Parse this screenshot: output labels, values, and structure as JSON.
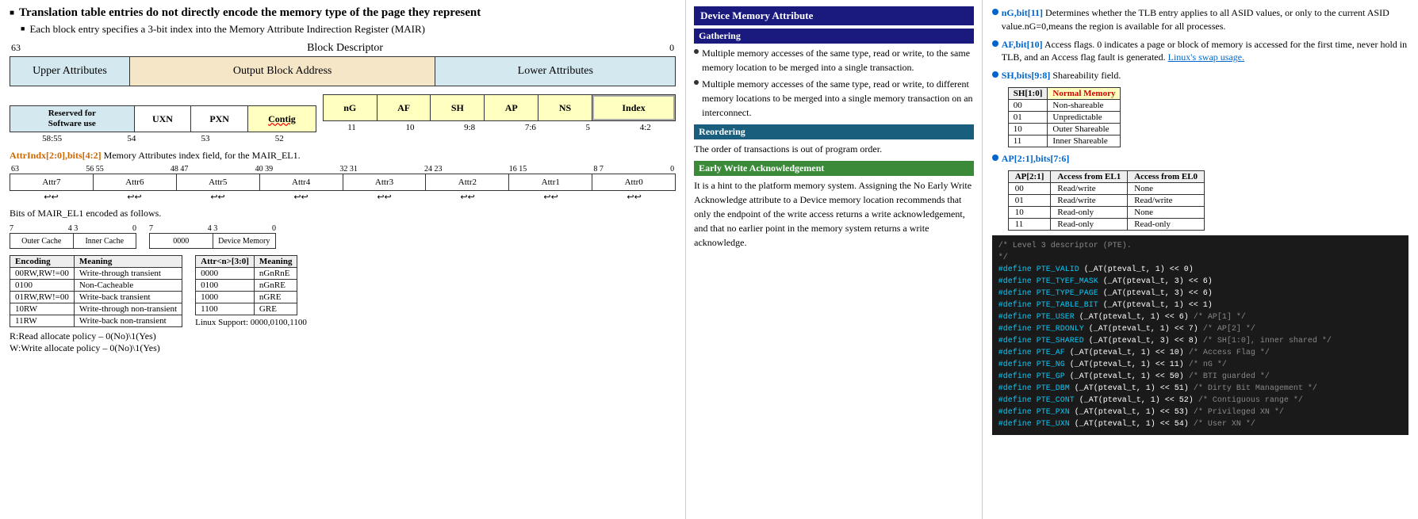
{
  "header": {
    "title": "Translation table entries do not directly encode the memory type of the page they represent",
    "subtitle": "Each block entry specifies a 3-bit index into the Memory Attribute Indirection Register (MAIR)"
  },
  "block_descriptor": {
    "title": "Block Descriptor",
    "bit_high": "63",
    "bit_low": "0",
    "boxes": [
      {
        "label": "Upper Attributes",
        "type": "upper"
      },
      {
        "label": "Output Block Address",
        "type": "output"
      },
      {
        "label": "Lower Attributes",
        "type": "lower"
      }
    ]
  },
  "lower_attrs": {
    "cells": [
      {
        "label": "Reserved for\nSoftware use",
        "type": "reserved",
        "bits": "58:55"
      },
      {
        "label": "UXN",
        "type": "uxn",
        "bits": "54"
      },
      {
        "label": "PXN",
        "type": "pxn",
        "bits": "53"
      },
      {
        "label": "Contig",
        "type": "contig",
        "bits": "52"
      },
      {
        "label": "nG",
        "type": "ng",
        "bits": "11"
      },
      {
        "label": "AF",
        "type": "af",
        "bits": "10"
      },
      {
        "label": "SH",
        "type": "sh",
        "bits": "9:8"
      },
      {
        "label": "AP",
        "type": "ap",
        "bits": "7:6"
      },
      {
        "label": "NS",
        "type": "ns",
        "bits": "5"
      },
      {
        "label": "Index",
        "type": "index",
        "bits": "4:2"
      }
    ]
  },
  "attr_indx": {
    "title_blue": "AttrIndx[2:0],bits[4:2]",
    "title_rest": " Memory Attributes index field, for the MAIR_EL1.",
    "bit_positions": [
      "63",
      "56 55",
      "48 47",
      "40 39",
      "32 31",
      "24 23",
      "16 15",
      "8  7",
      "0"
    ],
    "attr_labels": [
      "Attr7",
      "Attr6",
      "Attr5",
      "Attr4",
      "Attr3",
      "Attr2",
      "Attr1",
      "Attr0"
    ],
    "arrows": [
      "↩↩",
      "↩↩",
      "↩↩",
      "↩↩",
      "↩↩",
      "↩↩",
      "↩↩",
      "↩↩"
    ]
  },
  "mair_text": "Bits of MAIR_EL1 encoded as follows.",
  "mair_outer": {
    "bit_labels": [
      "7",
      "4 3",
      "0"
    ],
    "box_labels": [
      "Outer Cache",
      "Inner Cache"
    ],
    "sub_labels": [
      "0000",
      "Device Memory"
    ]
  },
  "encoding_table": {
    "headers": [
      "Encoding",
      "Meaning"
    ],
    "rows": [
      {
        "enc": "00RW,RW!=00",
        "meaning": "Write-through transient"
      },
      {
        "enc": "0100",
        "meaning": "Non-Cacheable"
      },
      {
        "enc": "01RW,RW!=00",
        "meaning": "Write-back transient"
      },
      {
        "enc": "10RW",
        "meaning": "Write-through non-transient"
      },
      {
        "enc": "11RW",
        "meaning": "Write-back non-transient"
      }
    ]
  },
  "attr_table": {
    "headers": [
      "Attr<n>[3:0]",
      "Meaning"
    ],
    "rows": [
      {
        "attr": "0000",
        "meaning": "nGnRnE"
      },
      {
        "attr": "0100",
        "meaning": "nGnRE"
      },
      {
        "attr": "1000",
        "meaning": "nGRE"
      },
      {
        "attr": "1100",
        "meaning": "GRE"
      }
    ],
    "linux_note": "Linux Support: 0000,0100,1100"
  },
  "rw_notes": [
    "R:Read allocate policy – 0(No)\\1(Yes)",
    "W:Write allocate policy – 0(No)\\1(Yes)"
  ],
  "right_panel": {
    "ng_text": "nG,bit[11]",
    "ng_desc": " Determines whether the TLB entry applies to all ASID values, or only to the current ASID value.nG=0,means the region is available for all processes.",
    "af_text": "AF,bit[10]",
    "af_desc": " Access flags. 0 indicates a page or block of memory is accessed for the first time, never hold in TLB, and an Access flag fault is generated. ",
    "af_link": "Linux's swap usage.",
    "sh_text": "SH,bits[9:8]",
    "sh_desc": " Shareability field.",
    "sh_table": {
      "headers": [
        "SH[1:0]",
        "Normal Memory"
      ],
      "rows": [
        {
          "val": "00",
          "meaning": "Non-shareable"
        },
        {
          "val": "01",
          "meaning": "Unpredictable"
        },
        {
          "val": "10",
          "meaning": "Outer Shareable"
        },
        {
          "val": "11",
          "meaning": "Inner Shareable"
        }
      ]
    },
    "ap_text": "AP[2:1],bits[7:6]",
    "ap_table": {
      "headers": [
        "AP[2:1]",
        "Access from EL1",
        "Access from EL0"
      ],
      "rows": [
        {
          "val": "00",
          "el1": "Read/write",
          "el0": "None"
        },
        {
          "val": "01",
          "el1": "Read/write",
          "el0": "Read/write"
        },
        {
          "val": "10",
          "el1": "Read-only",
          "el0": "None"
        },
        {
          "val": "11",
          "el1": "Read-only",
          "el0": "Read-only"
        }
      ]
    }
  },
  "device_memory": {
    "section_title": "Device Memory Attribute",
    "gathering_title": "Gathering",
    "gathering_bullets": [
      "Multiple memory accesses of the same type, read or write, to the same memory location to be merged into a single transaction.",
      "Multiple memory accesses of the same type, read or write, to different memory locations to be merged into a single memory transaction on an interconnect."
    ],
    "reorder_title": "Reordering",
    "reorder_text": "The order of transactions is out of program order.",
    "ewa_title": "Early Write Acknowledgement",
    "ewa_text": "It is a hint to the platform memory system. Assigning the No Early Write Acknowledge attribute to a Device memory location recommends that only the endpoint of the write access returns a write acknowledgement, and that no earlier point in the memory system returns a write acknowledge."
  },
  "code_section": {
    "comment1": "* Level 3 descriptor (PTE).",
    "comment2": "*/",
    "lines": [
      {
        "define": "#define",
        "name": "PTE_VALID",
        "value": "(_AT(pteval_t, 1) << 0)"
      },
      {
        "define": "#define",
        "name": "PTE_TYEF_MASK",
        "value": "(_AT(pteval_t, 3) << 6)"
      },
      {
        "define": "#define",
        "name": "PTE_TYPE_PAGE",
        "value": "(_AT(pteval_t, 3) << 6)"
      },
      {
        "define": "#define",
        "name": "PTE_TABLE_BIT",
        "value": "(_AT(pteval_t, 1) << 1)"
      },
      {
        "define": "#define",
        "name": "PTE_USER",
        "value": "(_AT(pteval_t, 1) << 6)   /* AP[1] */"
      },
      {
        "define": "#define",
        "name": "PTE_RDONLY",
        "value": "(_AT(pteval_t, 1) << 7)   /* AP[2] */"
      },
      {
        "define": "#define",
        "name": "PTE_SHARED",
        "value": "(_AT(pteval_t, 3) << 8)   /* SH[1:0], inner shared */"
      },
      {
        "define": "#define",
        "name": "PTE_AF",
        "value": "(_AT(pteval_t, 1) << 10)  /* Access Flag */"
      },
      {
        "define": "#define",
        "name": "PTE_NG",
        "value": "(_AT(pteval_t, 1) << 11)  /* nG */"
      },
      {
        "define": "#define",
        "name": "PTE_GP",
        "value": "(_AT(pteval_t, 1) << 50)  /* BTI guarded */"
      },
      {
        "define": "#define",
        "name": "PTE_DBM",
        "value": "(_AT(pteval_t, 1) << 51)  /* Dirty Bit Management */"
      },
      {
        "define": "#define",
        "name": "PTE_CONT",
        "value": "(_AT(pteval_t, 1) << 52)  /* Contiguous range */"
      },
      {
        "define": "#define",
        "name": "PTE_PXN",
        "value": "(_AT(pteval_t, 1) << 53)  /* Privileged XN */"
      },
      {
        "define": "#define",
        "name": "PTE_UXN",
        "value": "(_AT(pteval_t, 1) << 54)  /* User XN */"
      }
    ]
  }
}
